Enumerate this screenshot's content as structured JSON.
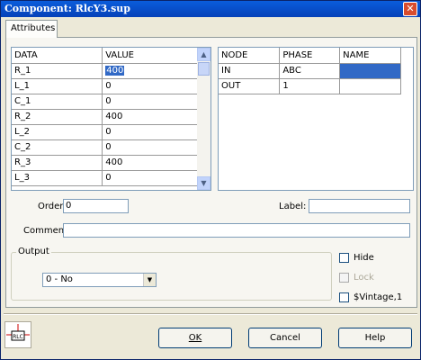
{
  "window": {
    "title": "Component: RlcY3.sup",
    "close_glyph": "✕"
  },
  "tabs": [
    {
      "label": "Attributes"
    }
  ],
  "data_grid": {
    "headers": [
      "DATA",
      "VALUE"
    ],
    "rows": [
      {
        "data": "R_1",
        "value": "400"
      },
      {
        "data": "L_1",
        "value": "0"
      },
      {
        "data": "C_1",
        "value": "0"
      },
      {
        "data": "R_2",
        "value": "400"
      },
      {
        "data": "L_2",
        "value": "0"
      },
      {
        "data": "C_2",
        "value": "0"
      },
      {
        "data": "R_3",
        "value": "400"
      },
      {
        "data": "L_3",
        "value": "0"
      }
    ]
  },
  "node_grid": {
    "headers": [
      "NODE",
      "PHASE",
      "NAME"
    ],
    "rows": [
      {
        "node": "IN",
        "phase": "ABC",
        "name": ""
      },
      {
        "node": "OUT",
        "phase": "1",
        "name": ""
      }
    ]
  },
  "fields": {
    "order_label": "Order:",
    "order_value": "0",
    "label_label": "Label:",
    "label_value": "",
    "comment_label": "Comment:",
    "comment_value": ""
  },
  "output": {
    "group_label": "Output",
    "selected": "0 - No"
  },
  "checkboxes": {
    "hide": "Hide",
    "lock": "Lock",
    "vintage": "$Vintage,1"
  },
  "buttons": {
    "ok": "OK",
    "cancel": "Cancel",
    "help": "Help"
  },
  "icon": {
    "name": "rlc-component-icon",
    "text": "RLC"
  },
  "colors": {
    "titlebar": "#0a5ddc",
    "selection": "#3169c6",
    "background": "#ece9d8"
  }
}
